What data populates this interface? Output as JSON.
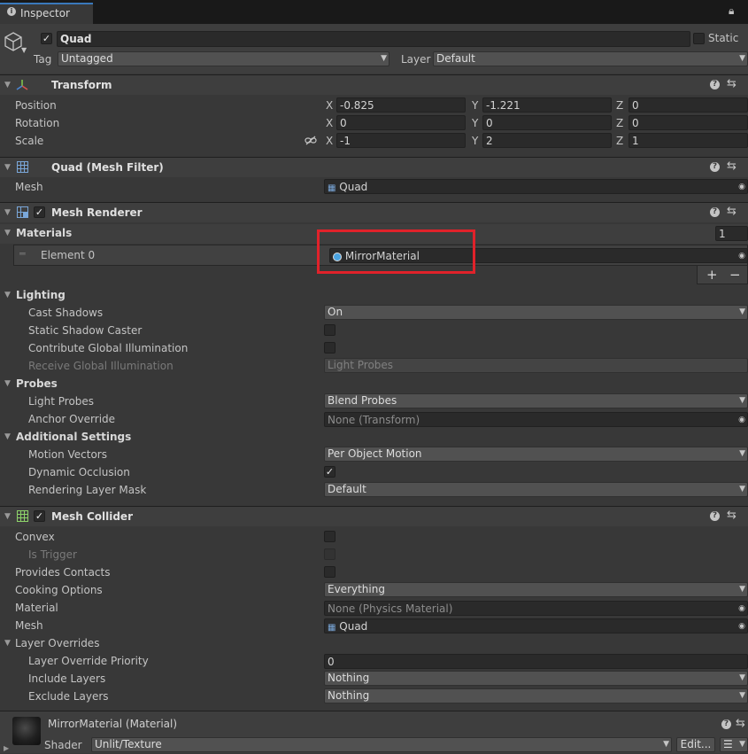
{
  "tab": {
    "title": "Inspector"
  },
  "gameobject": {
    "name": "Quad",
    "static_label": "Static",
    "tag_label": "Tag",
    "tag_value": "Untagged",
    "layer_label": "Layer",
    "layer_value": "Default"
  },
  "transform": {
    "title": "Transform",
    "position_label": "Position",
    "rotation_label": "Rotation",
    "scale_label": "Scale",
    "x": "X",
    "y": "Y",
    "z": "Z",
    "position": {
      "x": "-0.825",
      "y": "-1.221",
      "z": "0"
    },
    "rotation": {
      "x": "0",
      "y": "0",
      "z": "0"
    },
    "scale": {
      "x": "-1",
      "y": "2",
      "z": "1"
    }
  },
  "mesh_filter": {
    "title": "Quad (Mesh Filter)",
    "mesh_label": "Mesh",
    "mesh_value": "Quad"
  },
  "mesh_renderer": {
    "title": "Mesh Renderer",
    "materials_label": "Materials",
    "materials_count": "1",
    "element0_label": "Element 0",
    "element0_value": "MirrorMaterial",
    "add": "+",
    "remove": "−",
    "lighting_label": "Lighting",
    "cast_shadows_label": "Cast Shadows",
    "cast_shadows_value": "On",
    "static_shadow_label": "Static Shadow Caster",
    "contribute_gi_label": "Contribute Global Illumination",
    "receive_gi_label": "Receive Global Illumination",
    "receive_gi_value": "Light Probes",
    "probes_label": "Probes",
    "light_probes_label": "Light Probes",
    "light_probes_value": "Blend Probes",
    "anchor_label": "Anchor Override",
    "anchor_value": "None (Transform)",
    "additional_label": "Additional Settings",
    "motion_label": "Motion Vectors",
    "motion_value": "Per Object Motion",
    "dynamic_occlusion_label": "Dynamic Occlusion",
    "rendering_layer_label": "Rendering Layer Mask",
    "rendering_layer_value": "Default"
  },
  "mesh_collider": {
    "title": "Mesh Collider",
    "convex_label": "Convex",
    "is_trigger_label": "Is Trigger",
    "provides_contacts_label": "Provides Contacts",
    "cooking_label": "Cooking Options",
    "cooking_value": "Everything",
    "material_label": "Material",
    "material_value": "None (Physics Material)",
    "mesh_label": "Mesh",
    "mesh_value": "Quad",
    "layer_overrides_label": "Layer Overrides",
    "priority_label": "Layer Override Priority",
    "priority_value": "0",
    "include_label": "Include Layers",
    "include_value": "Nothing",
    "exclude_label": "Exclude Layers",
    "exclude_value": "Nothing"
  },
  "material": {
    "title": "MirrorMaterial (Material)",
    "shader_label": "Shader",
    "shader_value": "Unlit/Texture",
    "edit_label": "Edit..."
  },
  "colors": {
    "highlight": "#e0222a",
    "background": "#383838",
    "header": "#3e3e3e"
  }
}
